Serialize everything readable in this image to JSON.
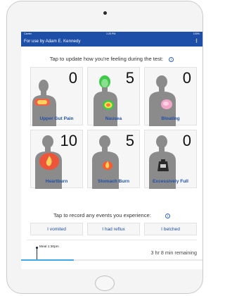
{
  "status": {
    "carrier": "Carrier",
    "time": "1:25 PM",
    "battery": "100%"
  },
  "app": {
    "title": "For use by Adam E. Kennedy",
    "menu_glyph": "⋮"
  },
  "symptoms": {
    "prompt": "Tap to update how you're feeling during the test:",
    "info_glyph": "i",
    "items": [
      {
        "label": "Upper Gut Pain",
        "score": "0"
      },
      {
        "label": "Nausea",
        "score": "5"
      },
      {
        "label": "Bloating",
        "score": "0"
      },
      {
        "label": "Heartburn",
        "score": "10"
      },
      {
        "label": "Stomach Burn",
        "score": "5"
      },
      {
        "label": "Excessively Full",
        "score": "0"
      }
    ]
  },
  "events": {
    "prompt": "Tap to record any events you experience:",
    "info_glyph": "i",
    "buttons": [
      "I vomited",
      "I had reflux",
      "I belched"
    ]
  },
  "timeline": {
    "meal_label": "Meal 1:30pm",
    "remaining": "3 hr 8 min remaining",
    "progress": 0.29
  },
  "colors": {
    "brand": "#1e4fa8",
    "progress": "#3fa9e6"
  }
}
